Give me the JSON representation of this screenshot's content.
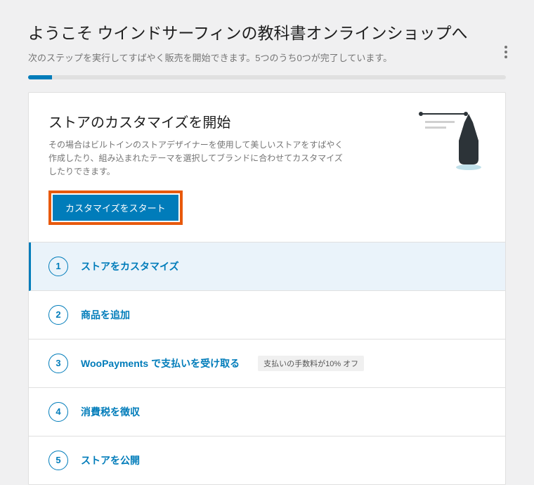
{
  "header": {
    "title": "ようこそ ウインドサーフィンの教科書オンラインショップへ",
    "subtitle": "次のステップを実行してすばやく販売を開始できます。5つのうち0つが完了しています。"
  },
  "card": {
    "title": "ストアのカスタマイズを開始",
    "desc": "その場合はビルトインのストアデザイナーを使用して美しいストアをすばやく作成したり、組み込まれたテーマを選択してブランドに合わせてカスタマイズしたりできます。",
    "button_label": "カスタマイズをスタート"
  },
  "steps": [
    {
      "num": "1",
      "label": "ストアをカスタマイズ",
      "active": true
    },
    {
      "num": "2",
      "label": "商品を追加"
    },
    {
      "num": "3",
      "label": "WooPayments で支払いを受け取る",
      "badge": "支払いの手数料が10% オフ"
    },
    {
      "num": "4",
      "label": "消費税を徴収"
    },
    {
      "num": "5",
      "label": "ストアを公開"
    }
  ]
}
